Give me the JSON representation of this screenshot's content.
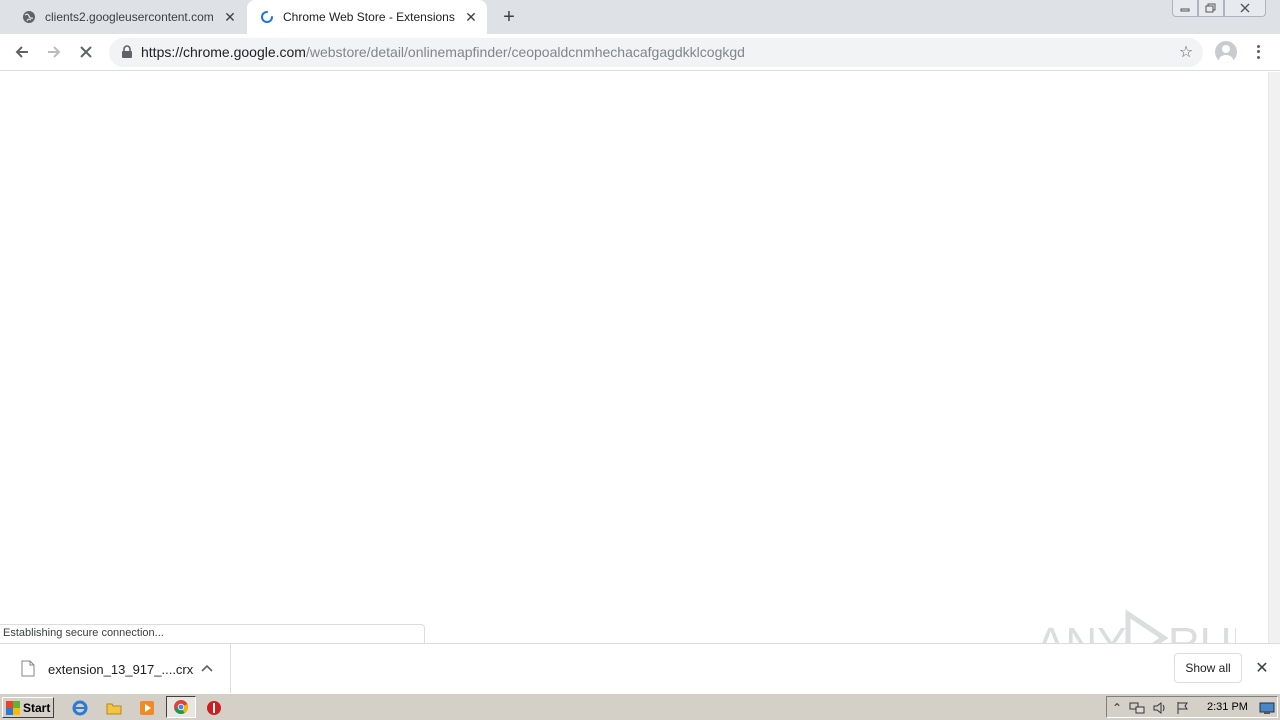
{
  "browser": {
    "tabs": [
      {
        "title": "clients2.googleusercontent.com",
        "active": false
      },
      {
        "title": "Chrome Web Store - Extensions",
        "active": true
      }
    ],
    "url_host": "https://chrome.google.com",
    "url_path": "/webstore/detail/onlinemapfinder/ceopoaldcnmhechacafgagdkklcogkgd",
    "status_text": "Establishing secure connection..."
  },
  "download_shelf": {
    "item_name": "extension_13_917_....crx",
    "show_all_label": "Show all"
  },
  "taskbar": {
    "start_label": "Start",
    "clock": "2:31 PM"
  },
  "watermark": {
    "text": "ANY RUN"
  }
}
